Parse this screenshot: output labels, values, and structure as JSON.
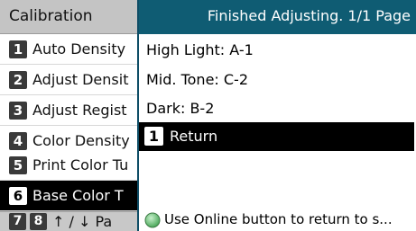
{
  "menu": {
    "title": "Calibration",
    "items": [
      {
        "number": "1",
        "label": "Auto Density"
      },
      {
        "number": "2",
        "label": "Adjust Densit"
      },
      {
        "number": "3",
        "label": "Adjust Regist"
      },
      {
        "number": "4",
        "label": "Color Density"
      },
      {
        "number": "5",
        "label": "Print Color Tu"
      },
      {
        "number": "6",
        "label": "Base Color T",
        "selected": true
      }
    ],
    "bottom": {
      "num1": "7",
      "num2": "8",
      "hint": "↑ / ↓ Pa"
    }
  },
  "popup": {
    "header": "Finished Adjusting.  1/1 Page",
    "lines": [
      "High Light: A-1",
      "Mid. Tone: C-2",
      "Dark: B-2"
    ],
    "return": {
      "number": "1",
      "label": "Return"
    },
    "footer": "Use Online button to return to s...",
    "footer_icon": "online-button-icon"
  },
  "colors": {
    "header_teal": "#0f5c73",
    "selected_bg": "#000000",
    "menu_title_bg": "#c4c4c4",
    "online_icon_green": "#5fbf6a"
  }
}
